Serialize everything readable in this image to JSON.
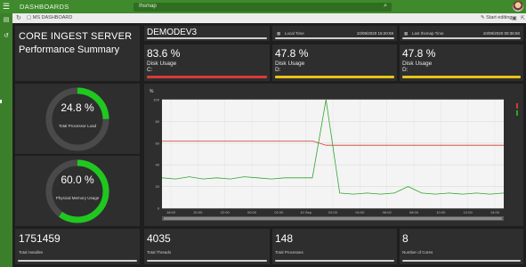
{
  "topbar": {
    "app_title": "DASHBOARDS",
    "search_value": "Ihsmap"
  },
  "subbar": {
    "breadcrumb": "MS DASHBOARD",
    "edit_label": "Start editing"
  },
  "header": {
    "line1": "CORE INGEST SERVER",
    "line2": "Performance Summary"
  },
  "host": {
    "name": "DEMODEV3"
  },
  "time_cards": [
    {
      "label": "Local Time",
      "value": "10/09/2020 15:20:59"
    },
    {
      "label": "Last Ihsmap Time",
      "value": "10/09/2020 00:36:50"
    }
  ],
  "disk_cards": [
    {
      "value": "83.6 %",
      "label": "Disk Usage",
      "drive": "C:",
      "bar_color": "#d83a3a",
      "fill": 0.836
    },
    {
      "value": "47.8 %",
      "label": "Disk Usage",
      "drive": "D:",
      "bar_color": "#e7c21a",
      "fill": 0.478
    },
    {
      "value": "47.8 %",
      "label": "Disk Usage",
      "drive": "D:",
      "bar_color": "#e7c21a",
      "fill": 0.478
    }
  ],
  "gauges": [
    {
      "value": "24.8 %",
      "label": "Total Processor Load",
      "fraction": 0.248
    },
    {
      "value": "60.0 %",
      "label": "Physical Memory Usage",
      "fraction": 0.6
    }
  ],
  "stats": [
    {
      "value": "1751459",
      "label": "Total Handles"
    },
    {
      "value": "4035",
      "label": "Total Threads"
    },
    {
      "value": "148",
      "label": "Total Processes"
    },
    {
      "value": "8",
      "label": "Number of Cores"
    }
  ],
  "colors": {
    "accent": "#3f8a2c",
    "gauge": "#1fc71f",
    "red_series": "#d23b2b",
    "green_series": "#2ea52e"
  },
  "chart_data": {
    "type": "line",
    "ylabel": "%",
    "ylim": [
      0,
      100
    ],
    "y_ticks": [
      "100",
      "80",
      "60",
      "40",
      "20",
      "0"
    ],
    "x_ticks": [
      "18:00",
      "20:00",
      "22:00",
      "00:00",
      "02:00",
      "10 Sep",
      "02:00",
      "04:00",
      "06:00",
      "08:00",
      "10:00",
      "12:00",
      "14:00"
    ],
    "series": [
      {
        "values": [
          62,
          62,
          62,
          62,
          62,
          62,
          62,
          62,
          62,
          62,
          62,
          62,
          58,
          58,
          58,
          58,
          58,
          58,
          58,
          58,
          58,
          58,
          58,
          58,
          58,
          58
        ]
      },
      {
        "values": [
          28,
          27,
          29,
          27,
          28,
          27,
          29,
          28,
          27,
          28,
          28,
          28,
          100,
          14,
          13,
          14,
          13,
          14,
          20,
          14,
          13,
          14,
          13,
          14,
          13,
          14
        ]
      }
    ]
  }
}
